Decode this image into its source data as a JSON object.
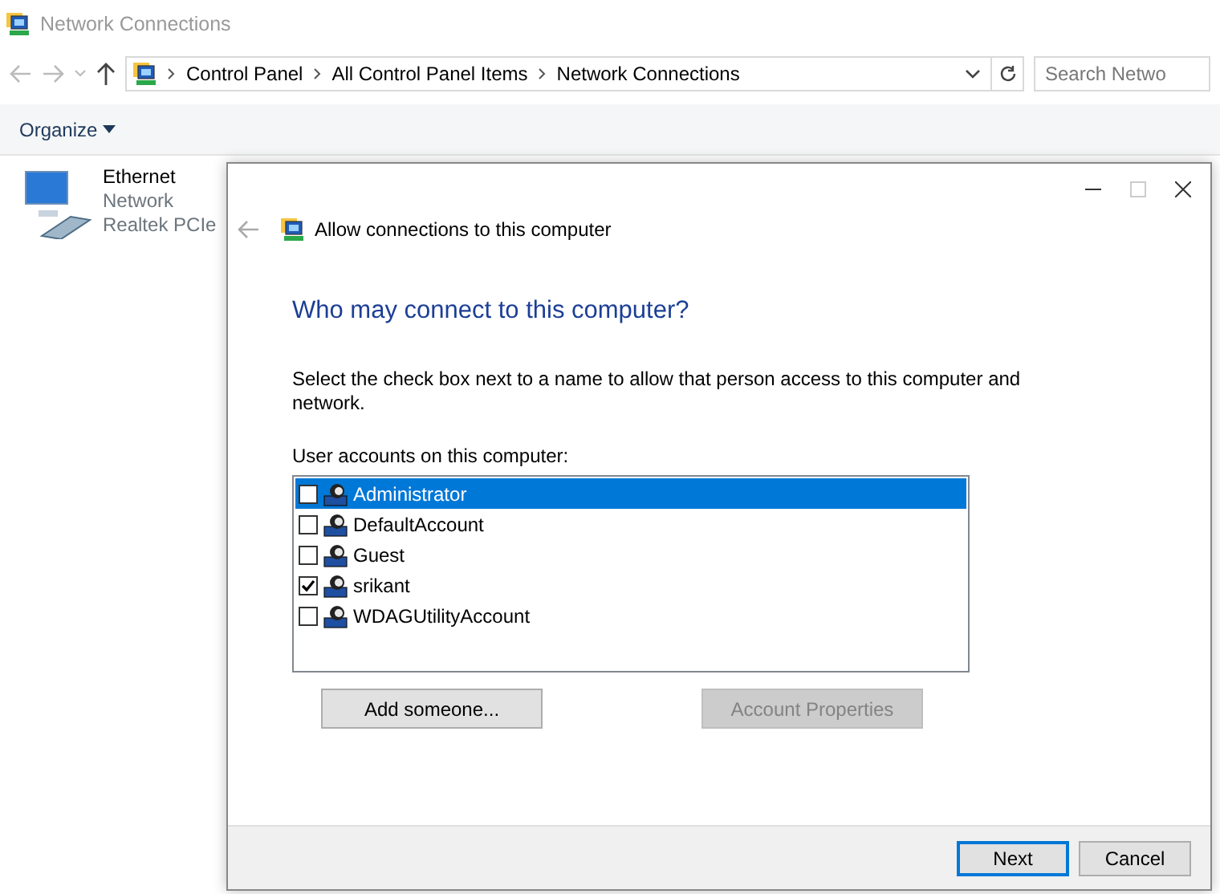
{
  "explorer": {
    "title": "Network Connections",
    "breadcrumbs": [
      "Control Panel",
      "All Control Panel Items",
      "Network Connections"
    ],
    "search": {
      "placeholder": "Search Netwo"
    },
    "toolbar": [
      "Organize"
    ],
    "items": [
      {
        "name": "Ethernet",
        "status": "Network",
        "device": "Realtek PCIe"
      }
    ]
  },
  "dialog": {
    "header": "Allow connections to this computer",
    "heading": "Who may connect to this computer?",
    "instruction": "Select the check box next to a name to allow that person access to this computer and network.",
    "list_label": "User accounts on this computer:",
    "accounts": [
      {
        "name": "Administrator",
        "checked": false,
        "selected": true
      },
      {
        "name": "DefaultAccount",
        "checked": false,
        "selected": false
      },
      {
        "name": "Guest",
        "checked": false,
        "selected": false
      },
      {
        "name": "srikant",
        "checked": true,
        "selected": false
      },
      {
        "name": "WDAGUtilityAccount",
        "checked": false,
        "selected": false
      }
    ],
    "actions": [
      {
        "label": "Add someone...",
        "disabled": false
      },
      {
        "label": "Account Properties",
        "disabled": true
      }
    ],
    "footer_buttons": [
      {
        "label": "Next",
        "default": true
      },
      {
        "label": "Cancel",
        "default": false
      }
    ]
  }
}
